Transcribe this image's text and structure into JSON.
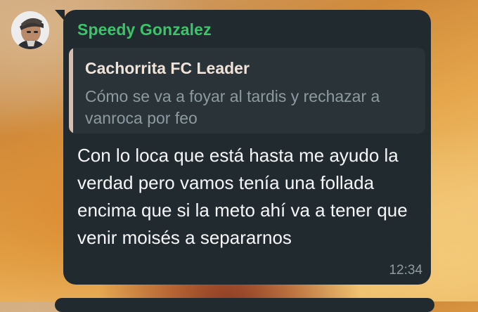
{
  "chat": {
    "sender": "Speedy Gonzalez",
    "reply": {
      "author": "Cachorrita FC Leader",
      "text": "Cómo se va a foyar al tardis y rechazar a vanroca por feo"
    },
    "message": "Con lo loca que está hasta me ayudo la verdad pero vamos tenía una follada encima que si la meto ahí va a tener que venir moisés a separarnos",
    "time": "12:34"
  },
  "colors": {
    "bubble": "#212b2f",
    "sender_name": "#3bc46a",
    "quote_bar": "#d7bfb0",
    "text": "#f4f6f7",
    "muted": "#8c9ba1"
  },
  "icons": {
    "avatar": "user-avatar"
  }
}
